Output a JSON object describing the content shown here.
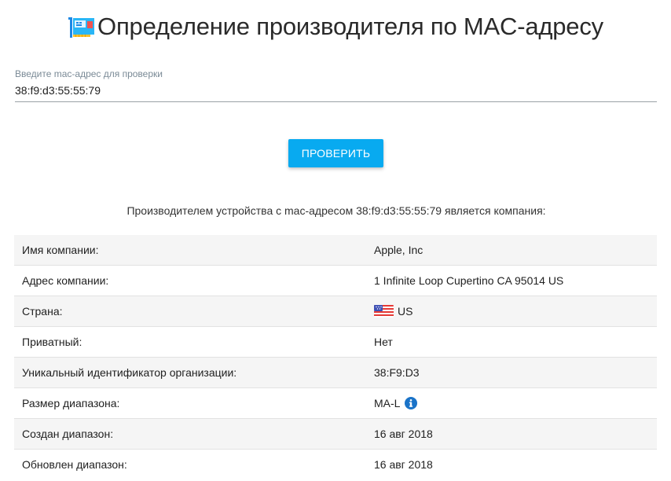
{
  "page": {
    "title": "Определение производителя по MAC-адресу"
  },
  "form": {
    "label": "Введите mac-адрес для проверки",
    "value": "38:f9:d3:55:55:79",
    "button": "ПРОВЕРИТЬ"
  },
  "result": {
    "text": "Производителем устройства с mac-адресом 38:f9:d3:55:55:79 является компания:"
  },
  "rows": [
    {
      "key": "Имя компании:",
      "value": "Apple, Inc"
    },
    {
      "key": "Адрес компании:",
      "value": "1 Infinite Loop Cupertino CA 95014 US"
    },
    {
      "key": "Страна:",
      "value": "US",
      "icon": "us-flag-icon"
    },
    {
      "key": "Приватный:",
      "value": "Нет"
    },
    {
      "key": "Уникальный идентификатор организации:",
      "value": "38:F9:D3"
    },
    {
      "key": "Размер диапазона:",
      "value": "MA-L",
      "icon": "info-icon"
    },
    {
      "key": "Создан диапазон:",
      "value": "16 авг 2018"
    },
    {
      "key": "Обновлен диапазон:",
      "value": "16 авг 2018"
    }
  ],
  "colors": {
    "accent": "#08aaf0",
    "row_stripe": "#f5f5f5"
  }
}
